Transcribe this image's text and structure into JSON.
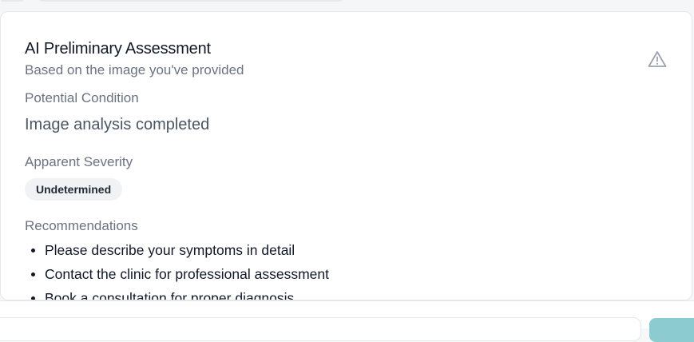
{
  "assessment": {
    "title": "AI Preliminary Assessment",
    "subtitle": "Based on the image you've provided",
    "warning_icon": "warning-triangle-icon",
    "condition_label": "Potential Condition",
    "condition_value": "Image analysis completed",
    "severity_label": "Apparent Severity",
    "severity_value": "Undetermined",
    "recommendations_label": "Recommendations",
    "recommendations": [
      "Please describe your symptoms in detail",
      "Contact the clinic for professional assessment",
      "Book a consultation for proper diagnosis"
    ]
  },
  "colors": {
    "send_button": "#8ccbd0",
    "muted_text": "#6b7280",
    "badge_bg": "#f1f2f4"
  }
}
